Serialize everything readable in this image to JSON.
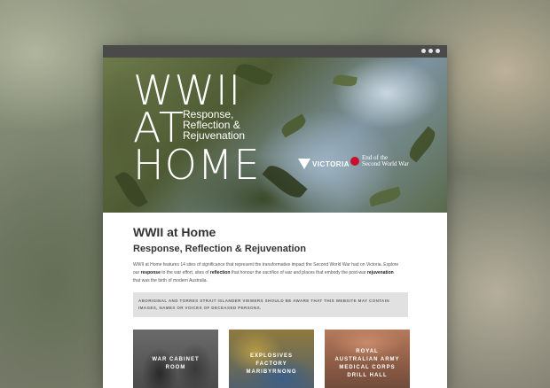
{
  "hero": {
    "title_lines": [
      "WWII",
      "AT",
      "HOME"
    ],
    "subtitle_lines": [
      "Response,",
      "Reflection &",
      "Rejuvenation"
    ],
    "victoria_logo": "VICTORIA",
    "end_of_war_logo": [
      "End of the",
      "Second World War"
    ]
  },
  "main": {
    "title": "WWII at Home",
    "subtitle": "Response, Reflection & Rejuvenation",
    "intro": {
      "part1": "WWII at Home features 14 sites of significance that represent the transformative impact the Second World War had on Victoria. Explore our ",
      "response": "response",
      "part2": " to the war effort, sites of ",
      "reflection": "reflection",
      "part3": " that honour the sacrifice of war and places that embody the post-war ",
      "rejuvenation": "rejuvenation",
      "part4": " that was the birth of modern Australia."
    },
    "notice": "Aboriginal and Torres Strait Islander viewers should be aware that this website may contain images, names or voices of deceased persons."
  },
  "cards": [
    {
      "label": "WAR CABINET ROOM"
    },
    {
      "label": "EXPLOSIVES FACTORY MARIBYRNONG"
    },
    {
      "label": "ROYAL AUSTRALIAN ARMY MEDICAL CORPS DRILL HALL"
    }
  ]
}
